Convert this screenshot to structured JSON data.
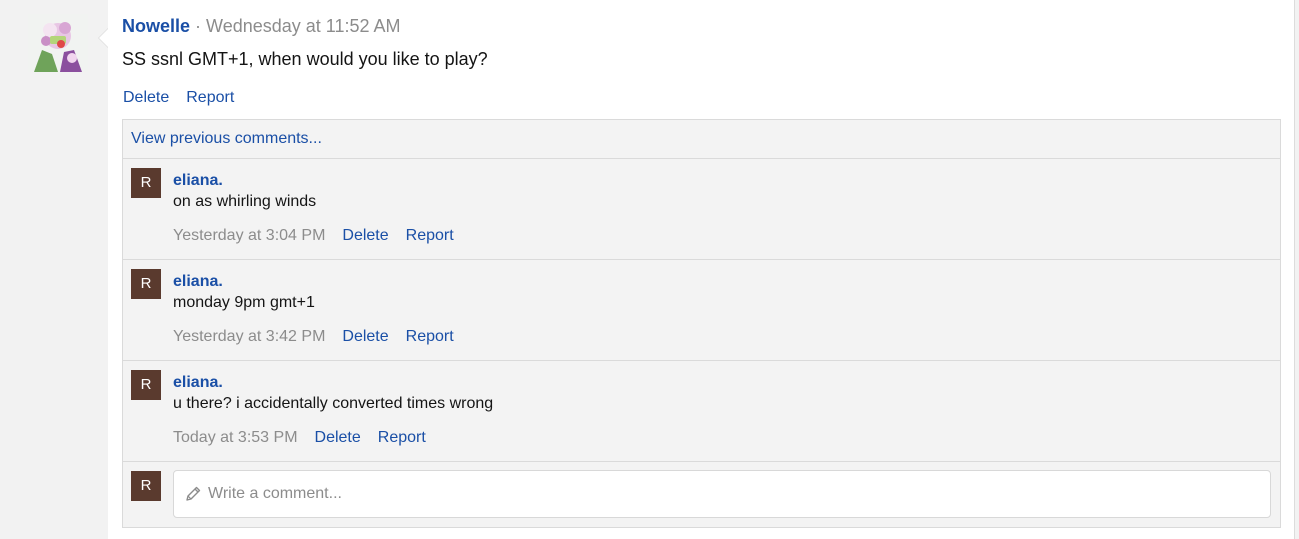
{
  "post": {
    "author": "Nowelle",
    "separator": " · ",
    "time": "Wednesday at 11:52 AM",
    "text": "SS ssnl GMT+1, when would you like to play?",
    "actions": {
      "delete": "Delete",
      "report": "Report"
    }
  },
  "comments_section": {
    "view_previous": "View previous comments...",
    "comments": [
      {
        "avatar_letter": "R",
        "author": "eliana.",
        "text": "on as whirling winds",
        "time": "Yesterday at 3:04 PM",
        "delete": "Delete",
        "report": "Report"
      },
      {
        "avatar_letter": "R",
        "author": "eliana.",
        "text": "monday 9pm gmt+1",
        "time": "Yesterday at 3:42 PM",
        "delete": "Delete",
        "report": "Report"
      },
      {
        "avatar_letter": "R",
        "author": "eliana.",
        "text": "u there? i accidentally converted times wrong",
        "time": "Today at 3:53 PM",
        "delete": "Delete",
        "report": "Report"
      }
    ],
    "composer": {
      "avatar_letter": "R",
      "placeholder": "Write a comment..."
    }
  },
  "icons": {
    "composer_icon": "pencil-icon"
  },
  "colors": {
    "link": "#1a4fa6",
    "avatar_bg": "#5a3a2e",
    "muted": "#8c8c8c"
  }
}
